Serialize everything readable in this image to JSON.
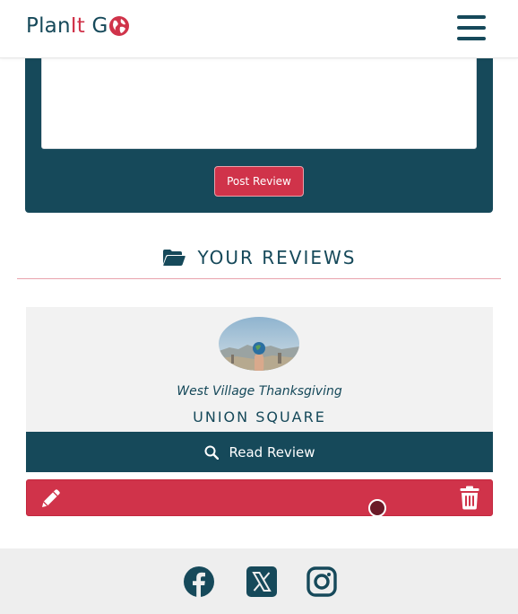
{
  "header": {
    "brand_prefix": "Plan",
    "brand_accent": "It",
    "brand_suffix": " G"
  },
  "form": {
    "textarea_value": "",
    "post_button_label": "Post Review"
  },
  "reviews_section": {
    "title": "YOUR REVIEWS",
    "items": [
      {
        "subtitle": "West Village Thanksgiving",
        "title": "UNION SQUARE",
        "read_button_label": "Read Review"
      }
    ]
  },
  "footer": {
    "social": [
      "facebook-icon",
      "x-icon",
      "instagram-icon"
    ]
  },
  "colors": {
    "primary": "#16495a",
    "accent": "#d0334a",
    "card_bg": "#f2f2f2",
    "footer_bg": "#eeeeee"
  }
}
